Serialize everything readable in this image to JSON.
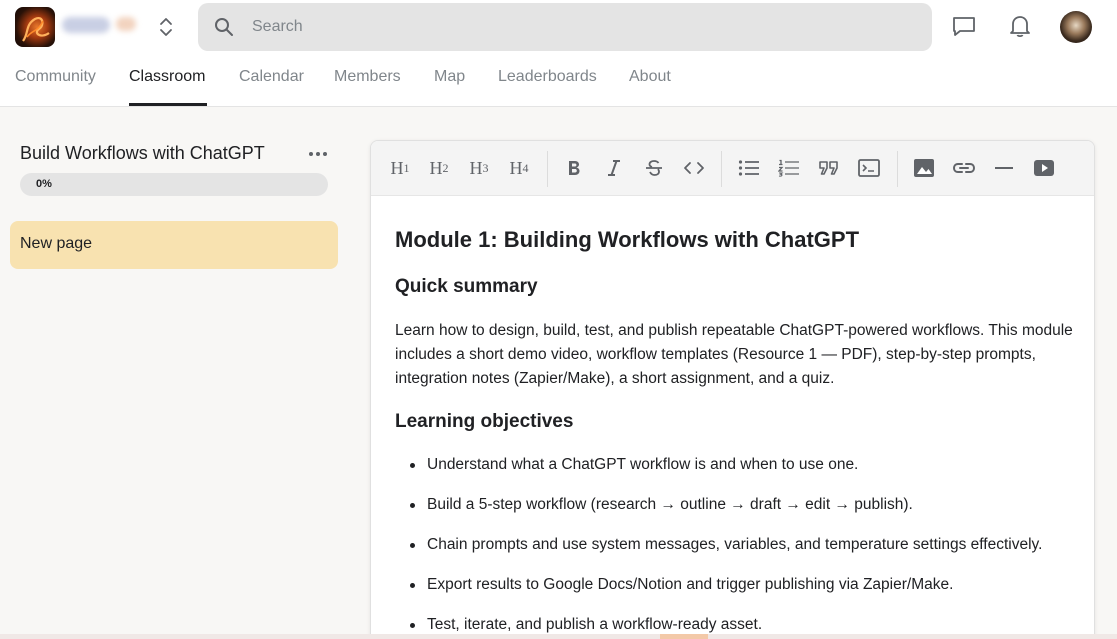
{
  "header": {
    "search_placeholder": "Search",
    "icons": [
      "group-logo",
      "chevron-updown-icon",
      "search-icon",
      "chat-icon",
      "bell-icon",
      "avatar"
    ]
  },
  "tabs": [
    {
      "label": "Community",
      "active": false
    },
    {
      "label": "Classroom",
      "active": true
    },
    {
      "label": "Calendar",
      "active": false
    },
    {
      "label": "Members",
      "active": false
    },
    {
      "label": "Map",
      "active": false
    },
    {
      "label": "Leaderboards",
      "active": false
    },
    {
      "label": "About",
      "active": false
    }
  ],
  "sidebar": {
    "course_title": "Build Workflows with ChatGPT",
    "progress_label": "0%",
    "progress_value": 0,
    "pages": [
      {
        "label": "New page",
        "selected": true
      }
    ]
  },
  "toolbar": {
    "tools": [
      "heading-1",
      "heading-2",
      "heading-3",
      "heading-4",
      "bold",
      "italic",
      "strikethrough",
      "inline-code",
      "bullet-list",
      "numbered-list",
      "blockquote",
      "code-block",
      "image",
      "link",
      "horizontal-rule",
      "video"
    ]
  },
  "content": {
    "title": "Module 1: Building Workflows with ChatGPT",
    "summary_heading": "Quick summary",
    "summary_text": "Learn how to design, build, test, and publish repeatable ChatGPT-powered workflows. This module includes a short demo video, workflow templates (Resource 1 — PDF), step-by-step prompts, integration notes (Zapier/Make), a short assignment, and a quiz.",
    "objectives_heading": "Learning objectives",
    "objectives": [
      "Understand what a ChatGPT workflow is and when to use one.",
      "Build a 5-step workflow (research → outline → draft → edit → publish).",
      "Chain prompts and use system messages, variables, and temperature settings effectively.",
      "Export results to Google Docs/Notion and trigger publishing via Zapier/Make.",
      "Test, iterate, and publish a workflow-ready asset."
    ]
  },
  "colors": {
    "accent_highlight": "#f8e2b0",
    "search_bg": "#e4e4e4",
    "page_bg": "#f8f7f5"
  }
}
